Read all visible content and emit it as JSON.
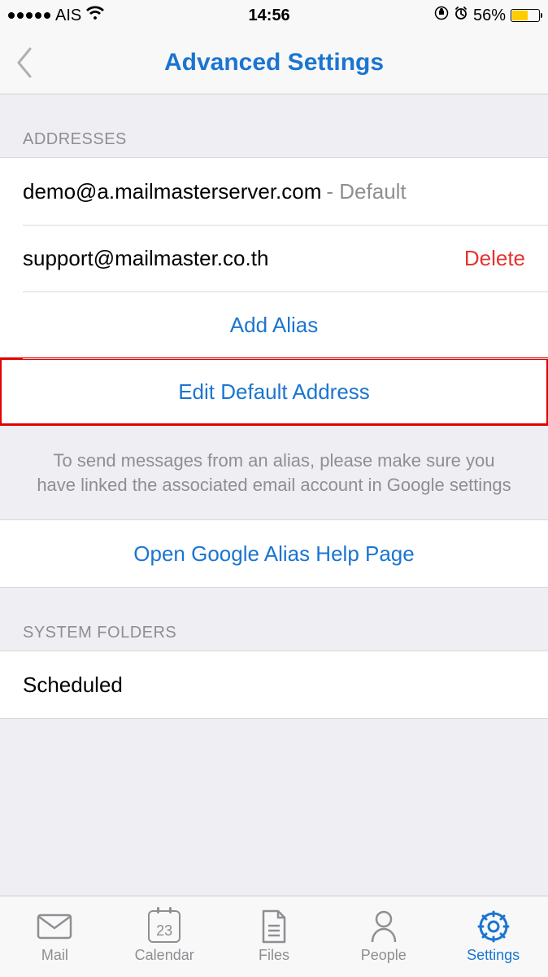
{
  "status": {
    "carrier": "AIS",
    "time": "14:56",
    "battery_pct": "56%"
  },
  "nav": {
    "title": "Advanced Settings"
  },
  "sections": {
    "addresses_header": "ADDRESSES",
    "addresses": [
      {
        "email": "demo@a.mailmasterserver.com",
        "suffix": "- Default",
        "action": ""
      },
      {
        "email": "support@mailmaster.co.th",
        "suffix": "",
        "action": "Delete"
      }
    ],
    "add_alias": "Add Alias",
    "edit_default": "Edit Default Address",
    "alias_note": "To send messages from an alias, please make sure you have linked the associated email account in Google settings",
    "open_help": "Open Google Alias Help Page",
    "system_folders_header": "SYSTEM FOLDERS",
    "system_folders": [
      {
        "label": "Scheduled"
      }
    ]
  },
  "tabs": {
    "mail": "Mail",
    "calendar": "Calendar",
    "calendar_day": "23",
    "files": "Files",
    "people": "People",
    "settings": "Settings"
  }
}
